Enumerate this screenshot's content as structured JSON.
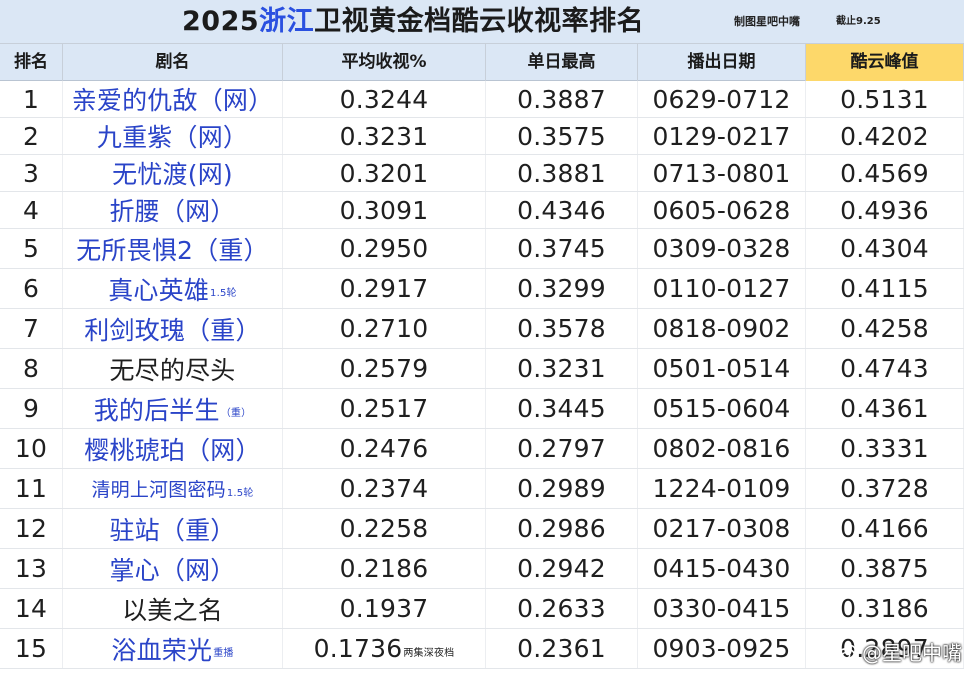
{
  "title": {
    "year": "2025",
    "highlight": "浙江",
    "rest": "卫视黄金档酷云收视率排名"
  },
  "credit": "制图星吧中嘴",
  "cutoff": "截止9.25",
  "headers": {
    "rank": "排名",
    "name": "剧名",
    "avg": "平均收视%",
    "max": "单日最高",
    "date": "播出日期",
    "peak": "酷云峰值"
  },
  "rows": [
    {
      "rank": "1",
      "name": "亲爱的仇敌（网）",
      "name_note": "",
      "avg": "0.3244",
      "avg_note": "",
      "max": "0.3887",
      "date": "0629-0712",
      "peak": "0.5131",
      "blue": true
    },
    {
      "rank": "2",
      "name": "九重紫（网）",
      "name_note": "",
      "avg": "0.3231",
      "avg_note": "",
      "max": "0.3575",
      "date": "0129-0217",
      "peak": "0.4202",
      "blue": true
    },
    {
      "rank": "3",
      "name": "无忧渡(网)",
      "name_note": "",
      "avg": "0.3201",
      "avg_note": "",
      "max": "0.3881",
      "date": "0713-0801",
      "peak": "0.4569",
      "blue": true
    },
    {
      "rank": "4",
      "name": "折腰（网）",
      "name_note": "",
      "avg": "0.3091",
      "avg_note": "",
      "max": "0.4346",
      "date": "0605-0628",
      "peak": "0.4936",
      "blue": true
    },
    {
      "rank": "5",
      "name": "无所畏惧2（重）",
      "name_note": "",
      "avg": "0.2950",
      "avg_note": "",
      "max": "0.3745",
      "date": "0309-0328",
      "peak": "0.4304",
      "blue": true
    },
    {
      "rank": "6",
      "name": "真心英雄",
      "name_note": "1.5轮",
      "avg": "0.2917",
      "avg_note": "",
      "max": "0.3299",
      "date": "0110-0127",
      "peak": "0.4115",
      "blue": true
    },
    {
      "rank": "7",
      "name": "利剑玫瑰（重）",
      "name_note": "",
      "avg": "0.2710",
      "avg_note": "",
      "max": "0.3578",
      "date": "0818-0902",
      "peak": "0.4258",
      "blue": true
    },
    {
      "rank": "8",
      "name": "无尽的尽头",
      "name_note": "",
      "avg": "0.2579",
      "avg_note": "",
      "max": "0.3231",
      "date": "0501-0514",
      "peak": "0.4743",
      "blue": false
    },
    {
      "rank": "9",
      "name": "我的后半生",
      "name_note": "（重）",
      "avg": "0.2517",
      "avg_note": "",
      "max": "0.3445",
      "date": "0515-0604",
      "peak": "0.4361",
      "blue": true
    },
    {
      "rank": "10",
      "name": "樱桃琥珀（网）",
      "name_note": "",
      "avg": "0.2476",
      "avg_note": "",
      "max": "0.2797",
      "date": "0802-0816",
      "peak": "0.3331",
      "blue": true
    },
    {
      "rank": "11",
      "name": "清明上河图密码",
      "name_note": "1.5轮",
      "avg": "0.2374",
      "avg_note": "",
      "max": "0.2989",
      "date": "1224-0109",
      "peak": "0.3728",
      "blue": true,
      "small": true
    },
    {
      "rank": "12",
      "name": "驻站（重）",
      "name_note": "",
      "avg": "0.2258",
      "avg_note": "",
      "max": "0.2986",
      "date": "0217-0308",
      "peak": "0.4166",
      "blue": true
    },
    {
      "rank": "13",
      "name": "掌心（网）",
      "name_note": "",
      "avg": "0.2186",
      "avg_note": "",
      "max": "0.2942",
      "date": "0415-0430",
      "peak": "0.3875",
      "blue": true
    },
    {
      "rank": "14",
      "name": "以美之名",
      "name_note": "",
      "avg": "0.1937",
      "avg_note": "",
      "max": "0.2633",
      "date": "0330-0415",
      "peak": "0.3186",
      "blue": false
    },
    {
      "rank": "15",
      "name": "浴血荣光",
      "name_note": "重播",
      "avg": "0.1736",
      "avg_note": "两集深夜档",
      "max": "0.2361",
      "date": "0903-0925",
      "peak": "0.2897",
      "blue": true
    }
  ],
  "watermark": "@星吧中嘴",
  "icons": {
    "watermark": "weibo-icon"
  }
}
